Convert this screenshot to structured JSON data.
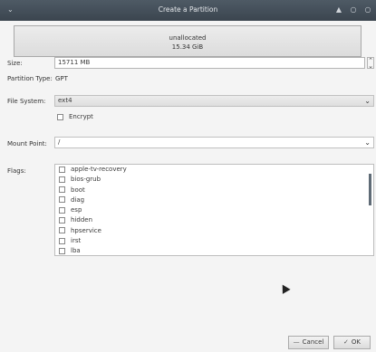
{
  "titlebar": {
    "menu_glyph": "⌄",
    "title": "Create a Partition",
    "btn_up": "▲",
    "btn_min": "○",
    "btn_close": "○"
  },
  "unallocated": {
    "label": "unallocated",
    "size": "15.34 GiB"
  },
  "size": {
    "label": "Size:",
    "value": "15711 MB",
    "spin_up": "⌃",
    "spin_down": "⌄"
  },
  "partition_type": {
    "label": "Partition Type:",
    "value": "GPT"
  },
  "file_system": {
    "label": "File System:",
    "value": "ext4",
    "arrow": "⌄"
  },
  "encrypt": {
    "label": "Encrypt",
    "checked": false
  },
  "mount_point": {
    "label": "Mount Point:",
    "value": "/",
    "arrow": "⌄"
  },
  "flags": {
    "label": "Flags:",
    "items": [
      {
        "label": "apple-tv-recovery",
        "checked": false
      },
      {
        "label": "bios-grub",
        "checked": false
      },
      {
        "label": "boot",
        "checked": false
      },
      {
        "label": "diag",
        "checked": false
      },
      {
        "label": "esp",
        "checked": false
      },
      {
        "label": "hidden",
        "checked": false
      },
      {
        "label": "hpservice",
        "checked": false
      },
      {
        "label": "irst",
        "checked": false
      },
      {
        "label": "lba",
        "checked": false
      }
    ]
  },
  "buttons": {
    "cancel_icon": "—",
    "cancel": "Cancel",
    "ok_icon": "✓",
    "ok": "OK"
  }
}
